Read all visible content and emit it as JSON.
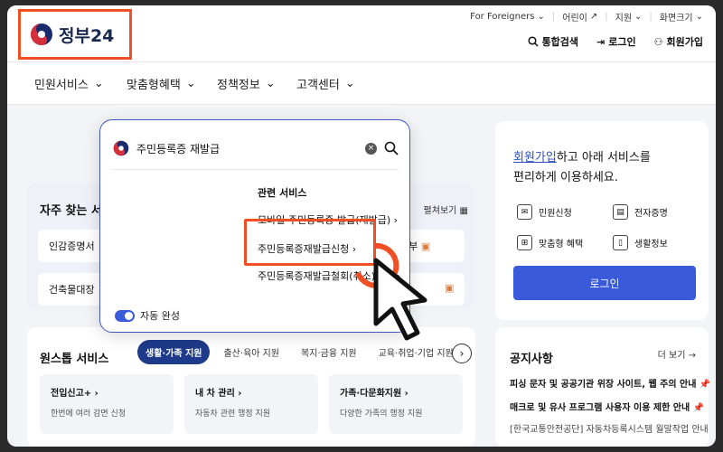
{
  "brand": {
    "name": "정부24",
    "accent": "#f04e23",
    "primary": "#3a5bd9"
  },
  "top_menu": {
    "foreigners": "For Foreigners",
    "children": "어린이",
    "support": "지원",
    "zoom": "화면크기"
  },
  "sub_nav": {
    "search": "통합검색",
    "login": "로그인",
    "signup": "회원가입"
  },
  "main_nav": [
    "민원서비스",
    "맞춤형혜택",
    "정책정보",
    "고객센터"
  ],
  "frequent": {
    "title": "자주 찾는 서비",
    "expand": "펼쳐보기",
    "chips": [
      "인감증명서",
      "건축물대장",
      "복원부"
    ]
  },
  "login_card": {
    "intro_link": "회원가입",
    "intro_rest": "하고 아래 서비스를",
    "intro_line2": "편리하게 이용하세요.",
    "services": [
      "민원신청",
      "전자증명",
      "맞춤형 혜택",
      "생활정보"
    ],
    "button": "로그인"
  },
  "onestop": {
    "title": "원스톱 서비스",
    "tabs": [
      "생활·가족 지원",
      "출산·육아 지원",
      "복지·금융 지원",
      "교육·취업·기업 지원"
    ],
    "cards": [
      {
        "h": "전입신고+ ›",
        "d": "한번에 여러 감면 신청"
      },
      {
        "h": "내 차 관리 ›",
        "d": "자동차 관련 행정 지원"
      },
      {
        "h": "가족·다문화지원 ›",
        "d": "다양한 가족의 행정 지원"
      }
    ]
  },
  "notice": {
    "title": "공지사항",
    "more": "더 보기 →",
    "items": [
      "피싱 문자 및 공공기관 위장 사이트, 웹 주의 안내 📌",
      "매크로 및 유사 프로그램 사용자 이용 제한 안내 📌",
      "[한국교통안전공단] 자동차등록시스템 월말작업 안내"
    ]
  },
  "search_popup": {
    "query": "주민등록증 재발급",
    "related_title": "관련 서비스",
    "related": [
      "모바일 주민등록증 발급(재발급) ›",
      "주민등록증재발급신청 ›",
      "주민등록증재발급철회(취소)신청 ›"
    ],
    "autocomplete": "자동 완성"
  }
}
